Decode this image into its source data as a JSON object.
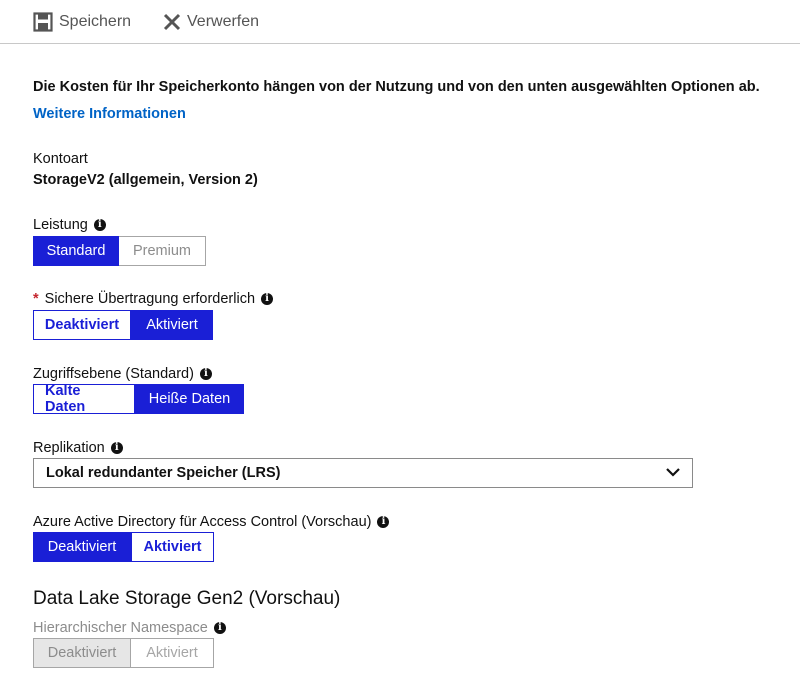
{
  "toolbar": {
    "save_label": "Speichern",
    "discard_label": "Verwerfen"
  },
  "intro_text": "Die Kosten für Ihr Speicherkonto hängen von der Nutzung und von den unten ausgewählten Optionen ab.",
  "more_info_link": "Weitere Informationen",
  "account_kind": {
    "label": "Kontoart",
    "value": "StorageV2 (allgemein, Version 2)"
  },
  "performance": {
    "label": "Leistung",
    "options": [
      "Standard",
      "Premium"
    ],
    "selected": "Standard"
  },
  "secure_transfer": {
    "required_marker": "*",
    "label": "Sichere Übertragung erforderlich",
    "options": [
      "Deaktiviert",
      "Aktiviert"
    ],
    "selected": "Aktiviert"
  },
  "access_tier": {
    "label": "Zugriffsebene (Standard)",
    "options": [
      "Kalte Daten",
      "Heiße Daten"
    ],
    "selected": "Heiße Daten"
  },
  "replication": {
    "label": "Replikation",
    "selected_value": "Lokal redundanter Speicher (LRS)"
  },
  "aad_access": {
    "label": "Azure Active Directory für Access Control (Vorschau)",
    "options": [
      "Deaktiviert",
      "Aktiviert"
    ],
    "selected": "Deaktiviert"
  },
  "data_lake": {
    "title": "Data Lake Storage Gen2 (Vorschau)",
    "namespace_label": "Hierarchischer Namespace",
    "options": [
      "Deaktiviert",
      "Aktiviert"
    ],
    "selected": "Deaktiviert",
    "disabled": true
  },
  "icons": {
    "save": "save-icon",
    "discard": "close-icon",
    "info": "info-icon",
    "dropdown": "chevron-down-icon"
  },
  "colors": {
    "accent": "#1a1fd6",
    "link": "#0063c6",
    "required": "#c4262e"
  }
}
